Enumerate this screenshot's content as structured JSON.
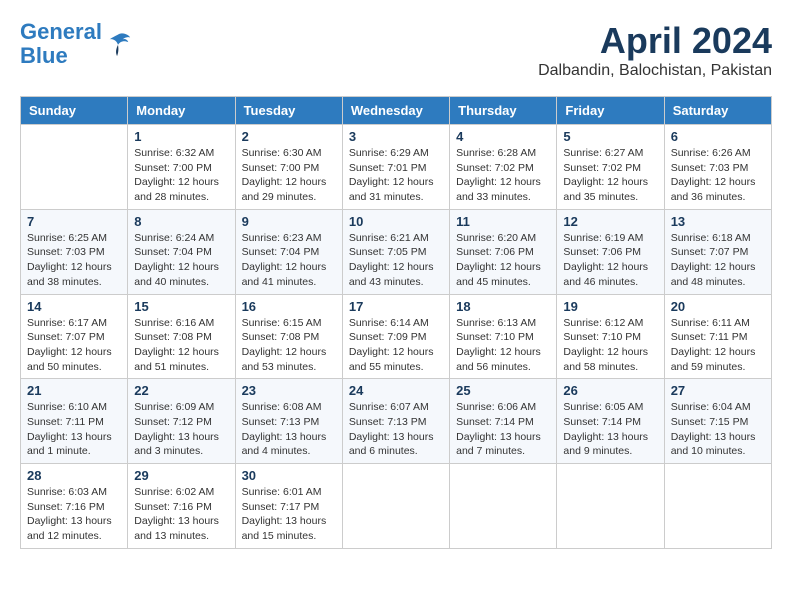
{
  "header": {
    "logo_line1": "General",
    "logo_line2": "Blue",
    "month_title": "April 2024",
    "location": "Dalbandin, Balochistan, Pakistan"
  },
  "weekdays": [
    "Sunday",
    "Monday",
    "Tuesday",
    "Wednesday",
    "Thursday",
    "Friday",
    "Saturday"
  ],
  "weeks": [
    [
      {
        "day": "",
        "info": ""
      },
      {
        "day": "1",
        "info": "Sunrise: 6:32 AM\nSunset: 7:00 PM\nDaylight: 12 hours\nand 28 minutes."
      },
      {
        "day": "2",
        "info": "Sunrise: 6:30 AM\nSunset: 7:00 PM\nDaylight: 12 hours\nand 29 minutes."
      },
      {
        "day": "3",
        "info": "Sunrise: 6:29 AM\nSunset: 7:01 PM\nDaylight: 12 hours\nand 31 minutes."
      },
      {
        "day": "4",
        "info": "Sunrise: 6:28 AM\nSunset: 7:02 PM\nDaylight: 12 hours\nand 33 minutes."
      },
      {
        "day": "5",
        "info": "Sunrise: 6:27 AM\nSunset: 7:02 PM\nDaylight: 12 hours\nand 35 minutes."
      },
      {
        "day": "6",
        "info": "Sunrise: 6:26 AM\nSunset: 7:03 PM\nDaylight: 12 hours\nand 36 minutes."
      }
    ],
    [
      {
        "day": "7",
        "info": "Sunrise: 6:25 AM\nSunset: 7:03 PM\nDaylight: 12 hours\nand 38 minutes."
      },
      {
        "day": "8",
        "info": "Sunrise: 6:24 AM\nSunset: 7:04 PM\nDaylight: 12 hours\nand 40 minutes."
      },
      {
        "day": "9",
        "info": "Sunrise: 6:23 AM\nSunset: 7:04 PM\nDaylight: 12 hours\nand 41 minutes."
      },
      {
        "day": "10",
        "info": "Sunrise: 6:21 AM\nSunset: 7:05 PM\nDaylight: 12 hours\nand 43 minutes."
      },
      {
        "day": "11",
        "info": "Sunrise: 6:20 AM\nSunset: 7:06 PM\nDaylight: 12 hours\nand 45 minutes."
      },
      {
        "day": "12",
        "info": "Sunrise: 6:19 AM\nSunset: 7:06 PM\nDaylight: 12 hours\nand 46 minutes."
      },
      {
        "day": "13",
        "info": "Sunrise: 6:18 AM\nSunset: 7:07 PM\nDaylight: 12 hours\nand 48 minutes."
      }
    ],
    [
      {
        "day": "14",
        "info": "Sunrise: 6:17 AM\nSunset: 7:07 PM\nDaylight: 12 hours\nand 50 minutes."
      },
      {
        "day": "15",
        "info": "Sunrise: 6:16 AM\nSunset: 7:08 PM\nDaylight: 12 hours\nand 51 minutes."
      },
      {
        "day": "16",
        "info": "Sunrise: 6:15 AM\nSunset: 7:08 PM\nDaylight: 12 hours\nand 53 minutes."
      },
      {
        "day": "17",
        "info": "Sunrise: 6:14 AM\nSunset: 7:09 PM\nDaylight: 12 hours\nand 55 minutes."
      },
      {
        "day": "18",
        "info": "Sunrise: 6:13 AM\nSunset: 7:10 PM\nDaylight: 12 hours\nand 56 minutes."
      },
      {
        "day": "19",
        "info": "Sunrise: 6:12 AM\nSunset: 7:10 PM\nDaylight: 12 hours\nand 58 minutes."
      },
      {
        "day": "20",
        "info": "Sunrise: 6:11 AM\nSunset: 7:11 PM\nDaylight: 12 hours\nand 59 minutes."
      }
    ],
    [
      {
        "day": "21",
        "info": "Sunrise: 6:10 AM\nSunset: 7:11 PM\nDaylight: 13 hours\nand 1 minute."
      },
      {
        "day": "22",
        "info": "Sunrise: 6:09 AM\nSunset: 7:12 PM\nDaylight: 13 hours\nand 3 minutes."
      },
      {
        "day": "23",
        "info": "Sunrise: 6:08 AM\nSunset: 7:13 PM\nDaylight: 13 hours\nand 4 minutes."
      },
      {
        "day": "24",
        "info": "Sunrise: 6:07 AM\nSunset: 7:13 PM\nDaylight: 13 hours\nand 6 minutes."
      },
      {
        "day": "25",
        "info": "Sunrise: 6:06 AM\nSunset: 7:14 PM\nDaylight: 13 hours\nand 7 minutes."
      },
      {
        "day": "26",
        "info": "Sunrise: 6:05 AM\nSunset: 7:14 PM\nDaylight: 13 hours\nand 9 minutes."
      },
      {
        "day": "27",
        "info": "Sunrise: 6:04 AM\nSunset: 7:15 PM\nDaylight: 13 hours\nand 10 minutes."
      }
    ],
    [
      {
        "day": "28",
        "info": "Sunrise: 6:03 AM\nSunset: 7:16 PM\nDaylight: 13 hours\nand 12 minutes."
      },
      {
        "day": "29",
        "info": "Sunrise: 6:02 AM\nSunset: 7:16 PM\nDaylight: 13 hours\nand 13 minutes."
      },
      {
        "day": "30",
        "info": "Sunrise: 6:01 AM\nSunset: 7:17 PM\nDaylight: 13 hours\nand 15 minutes."
      },
      {
        "day": "",
        "info": ""
      },
      {
        "day": "",
        "info": ""
      },
      {
        "day": "",
        "info": ""
      },
      {
        "day": "",
        "info": ""
      }
    ]
  ]
}
